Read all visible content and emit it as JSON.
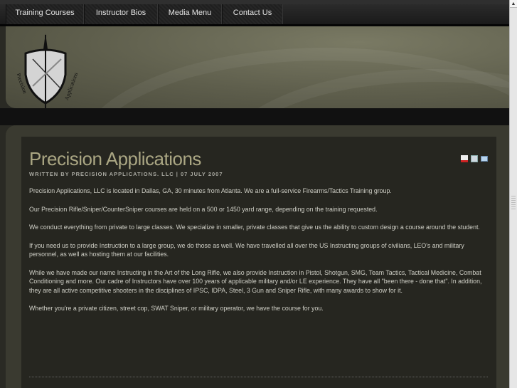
{
  "nav": {
    "items": [
      "Training Courses",
      "Instructor Bios",
      "Media Menu",
      "Contact Us"
    ]
  },
  "logo": {
    "text_left": "Precision",
    "text_right": "Applications"
  },
  "article": {
    "title": "Precision Applications",
    "meta": "WRITTEN BY PRECISION APPLICATIONS. LLC | 07 JULY 2007",
    "icons": [
      "pdf-icon",
      "print-icon",
      "email-icon"
    ],
    "paragraphs": [
      "Precision Applications, LLC is located in Dallas, GA, 30 minutes from Atlanta. We are a full-service Firearms/Tactics Training group.",
      "Our Precision Rifle/Sniper/CounterSniper courses are held on a 500 or 1450 yard range, depending on the training requested.",
      "We conduct everything from private to large classes.  We specialize in smaller, private classes that give us the ability to custom design a course around the student.",
      "If you need us to provide Instruction to a large group, we do those as well.  We have travelled all over the US Instructing groups of civilians, LEO's and military personnel, as well as hosting them at our facilities.",
      "While we have made our name Instructing in the Art of the Long Rifle, we also provide Instruction in Pistol, Shotgun, SMG, Team Tactics, Tactical Medicine, Combat Conditioning and more.  Our cadre of Instructors have over 100 years of applicable military and/or LE experience.  They have all \"been there - done that\".  In addition, they are all active competitive shooters in the disciplines of IPSC, IDPA, Steel, 3 Gun and Sniper Rifle, with many awards to show for it.",
      "Whether you're a private citizen, street cop, SWAT Sniper, or military operator, we have the course for you."
    ]
  }
}
